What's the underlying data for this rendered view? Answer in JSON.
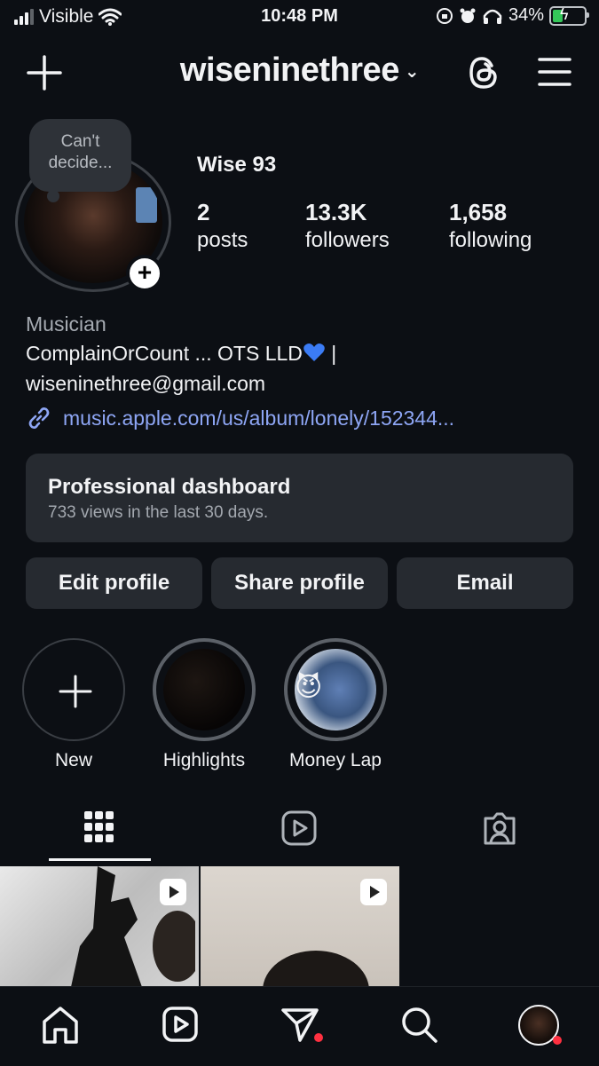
{
  "status": {
    "carrier": "Visible",
    "time": "10:48 PM",
    "battery": "34%"
  },
  "header": {
    "username": "wiseninethree",
    "chevron": "⌄"
  },
  "profile": {
    "note": "Can't decide...",
    "display_name": "Wise 93",
    "stats": [
      {
        "num": "2",
        "label": "posts"
      },
      {
        "num": "13.3K",
        "label": "followers"
      },
      {
        "num": "1,658",
        "label": "following"
      }
    ],
    "category": "Musician",
    "bio_line1": "ComplainOrCount ... OTS LLD",
    "bio_sep": " |",
    "bio_line2": "wiseninethree@gmail.com",
    "link": "music.apple.com/us/album/lonely/152344..."
  },
  "dashboard": {
    "title": "Professional dashboard",
    "subtitle": "733 views in the last 30 days."
  },
  "buttons": {
    "edit": "Edit profile",
    "share": "Share profile",
    "email": "Email"
  },
  "highlights": [
    {
      "label": "New"
    },
    {
      "label": "Highlights"
    },
    {
      "label": "Money Lap"
    }
  ],
  "icons": {
    "emoji_devil": "😈"
  },
  "colors": {
    "background": "#0c0f14",
    "surface": "#262a30",
    "link": "#8ea6f5",
    "notification_dot": "#ff3040",
    "battery_fill": "#34c759"
  }
}
